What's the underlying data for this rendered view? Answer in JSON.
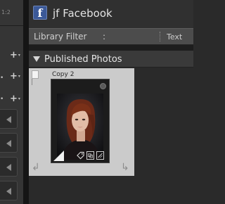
{
  "left_panel": {
    "crop_ratio": "1:2",
    "dots": [
      "•",
      "•"
    ],
    "add_buttons": [
      {
        "symbol": "+",
        "dropdown": "▾"
      },
      {
        "symbol": "+",
        "dropdown": "▾"
      },
      {
        "symbol": "+",
        "dropdown": "▾"
      }
    ]
  },
  "header": {
    "logo_letter": "f",
    "title": "jf Facebook"
  },
  "filter_bar": {
    "label": "Library Filter",
    "colon": ":",
    "text_option": "Text"
  },
  "section": {
    "title": "Published Photos"
  },
  "photo": {
    "copy_name": "Copy 2"
  },
  "colors": {
    "facebook_blue": "#3b5998",
    "cell_background": "#cbcbcb",
    "filter_bar": "#4c4c4c"
  },
  "icons": [
    "flag-icon",
    "rotate-left-icon",
    "rotate-right-icon",
    "keyword-badge-icon",
    "crop-badge-icon",
    "develop-badge-icon",
    "collapse-triangle-icon"
  ]
}
